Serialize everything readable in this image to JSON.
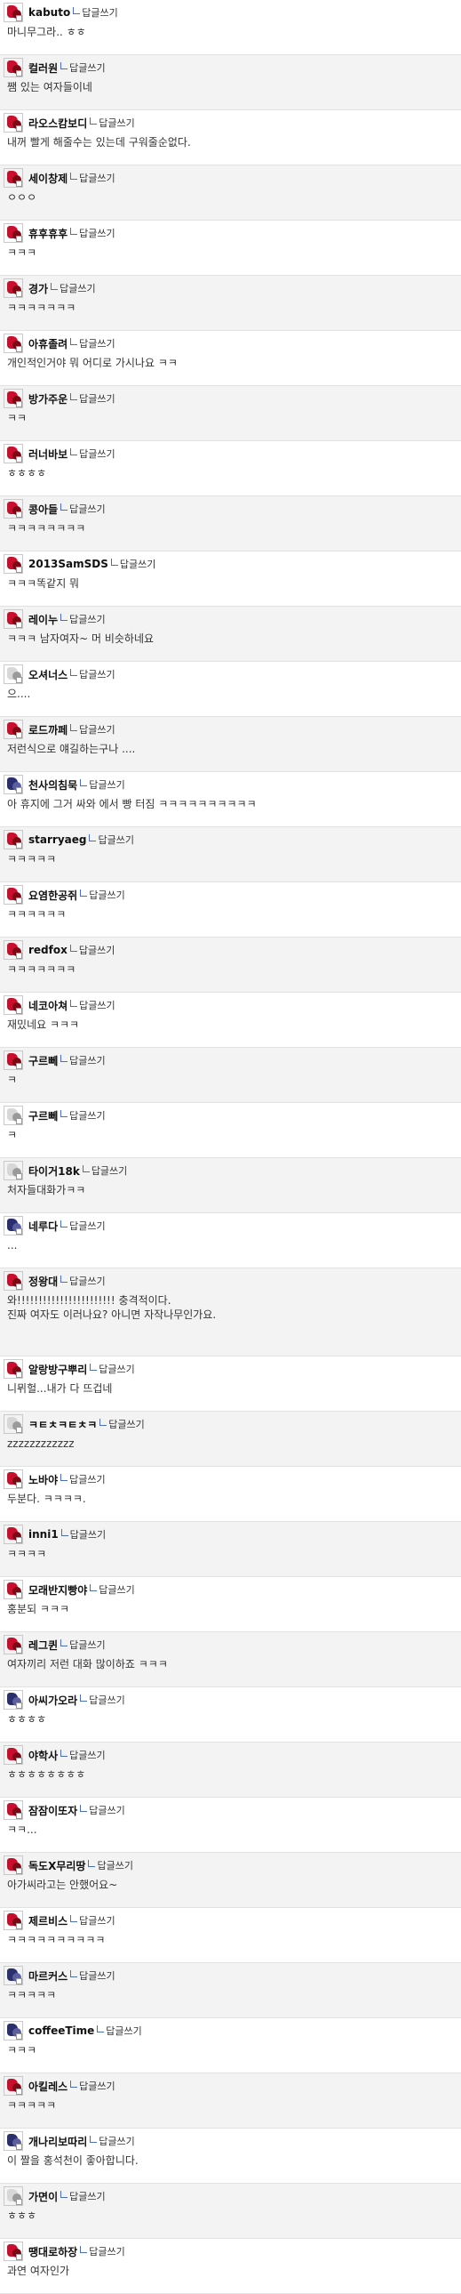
{
  "reply_label": "답글쓰기",
  "comments": [
    {
      "nick": "kabuto",
      "text": "마니무그라.. ㅎㅎ"
    },
    {
      "nick": "컬러원",
      "text": "쨈 있는 여자들이네"
    },
    {
      "nick": "라오스캄보디",
      "text": "내꺼 빨게 해줄수는 있는데 구워줄순없다."
    },
    {
      "nick": "세이창제",
      "text": "ㅇㅇㅇ"
    },
    {
      "nick": "휴후휴후",
      "text": "ㅋㅋㅋ"
    },
    {
      "nick": "경가",
      "text": "ㅋㅋㅋㅋㅋㅋㅋ"
    },
    {
      "nick": "아휴졸려",
      "text": "개인적인거야 뭐 어디로 가시나요 ㅋㅋ"
    },
    {
      "nick": "방가주운",
      "text": "ㅋㅋ"
    },
    {
      "nick": "러너바보",
      "text": "ㅎㅎㅎㅎ"
    },
    {
      "nick": "콩아들",
      "text": "ㅋㅋㅋㅋㅋㅋㅋㅋ"
    },
    {
      "nick": "2013SamSDS",
      "text": "ㅋㅋㅋ똑같지 뭐"
    },
    {
      "nick": "레이누",
      "text": "ㅋㅋㅋ 남자여자~ 머 비슷하네요"
    },
    {
      "nick": "오셔너스",
      "text": "으...."
    },
    {
      "nick": "로드까페",
      "text": "저런식으로 얘길하는구나 ...."
    },
    {
      "nick": "천사의침묵",
      "text": "아 휴지에 그거 싸와 에서 빵 터짐 ㅋㅋㅋㅋㅋㅋㅋㅋㅋㅋ"
    },
    {
      "nick": "starryaeg",
      "text": "ㅋㅋㅋㅋㅋ"
    },
    {
      "nick": "요염한공쥐",
      "text": "ㅋㅋㅋㅋㅋㅋ"
    },
    {
      "nick": "redfox",
      "text": "ㅋㅋㅋㅋㅋㅋㅋ"
    },
    {
      "nick": "네코아쳐",
      "text": "재밌네요 ㅋㅋㅋ"
    },
    {
      "nick": "구르뻬",
      "text": "ㅋ"
    },
    {
      "nick": "구르뻬",
      "text": "ㅋ"
    },
    {
      "nick": "타이거18k",
      "text": "처자들대화가ㅋㅋ"
    },
    {
      "nick": "네루다",
      "text": "..."
    },
    {
      "nick": "정왕대",
      "text": "와!!!!!!!!!!!!!!!!!!!!!!! 충격적이다.\n진짜 여자도 이러나요? 아니면 자작나무인가요."
    },
    {
      "nick": "알랑방구뿌리",
      "text": "니뮈헐...내가 다 뜨겁네"
    },
    {
      "nick": "ㅋㅌㅊㅋㅌㅊㅋ",
      "text": "zzzzzzzzzzzz"
    },
    {
      "nick": "노바야",
      "text": "두분다. ㅋㅋㅋㅋ."
    },
    {
      "nick": "inni1",
      "text": "ㅋㅋㅋㅋ"
    },
    {
      "nick": "모래반지빵야",
      "text": "홍분되 ㅋㅋㅋ"
    },
    {
      "nick": "레그퀸",
      "text": "여자끼리 저런 대화 많이하죠 ㅋㅋㅋ"
    },
    {
      "nick": "아씨가오라",
      "text": "ㅎㅎㅎㅎ"
    },
    {
      "nick": "야학사",
      "text": "ㅎㅎㅎㅎㅎㅎㅎㅎ"
    },
    {
      "nick": "잠잠이또자",
      "text": "ㅋㅋ..."
    },
    {
      "nick": "독도X무리땅",
      "text": "아가씨라고는 안했어요~"
    },
    {
      "nick": "제르비스",
      "text": "ㅋㅋㅋㅋㅋㅋㅋㅋㅋㅋ"
    },
    {
      "nick": "마르커스",
      "text": "ㅋㅋㅋㅋㅋ"
    },
    {
      "nick": "coffeeTime",
      "text": "ㅋㅋㅋ"
    },
    {
      "nick": "아킬레스",
      "text": "ㅋㅋㅋㅋㅋ"
    },
    {
      "nick": "개나리보따리",
      "text": "이 짤을 홍석천이 좋아합니다."
    },
    {
      "nick": "가면이",
      "text": "ㅎㅎㅎ"
    },
    {
      "nick": "땡대로하장",
      "text": "과연 여자인가"
    }
  ]
}
